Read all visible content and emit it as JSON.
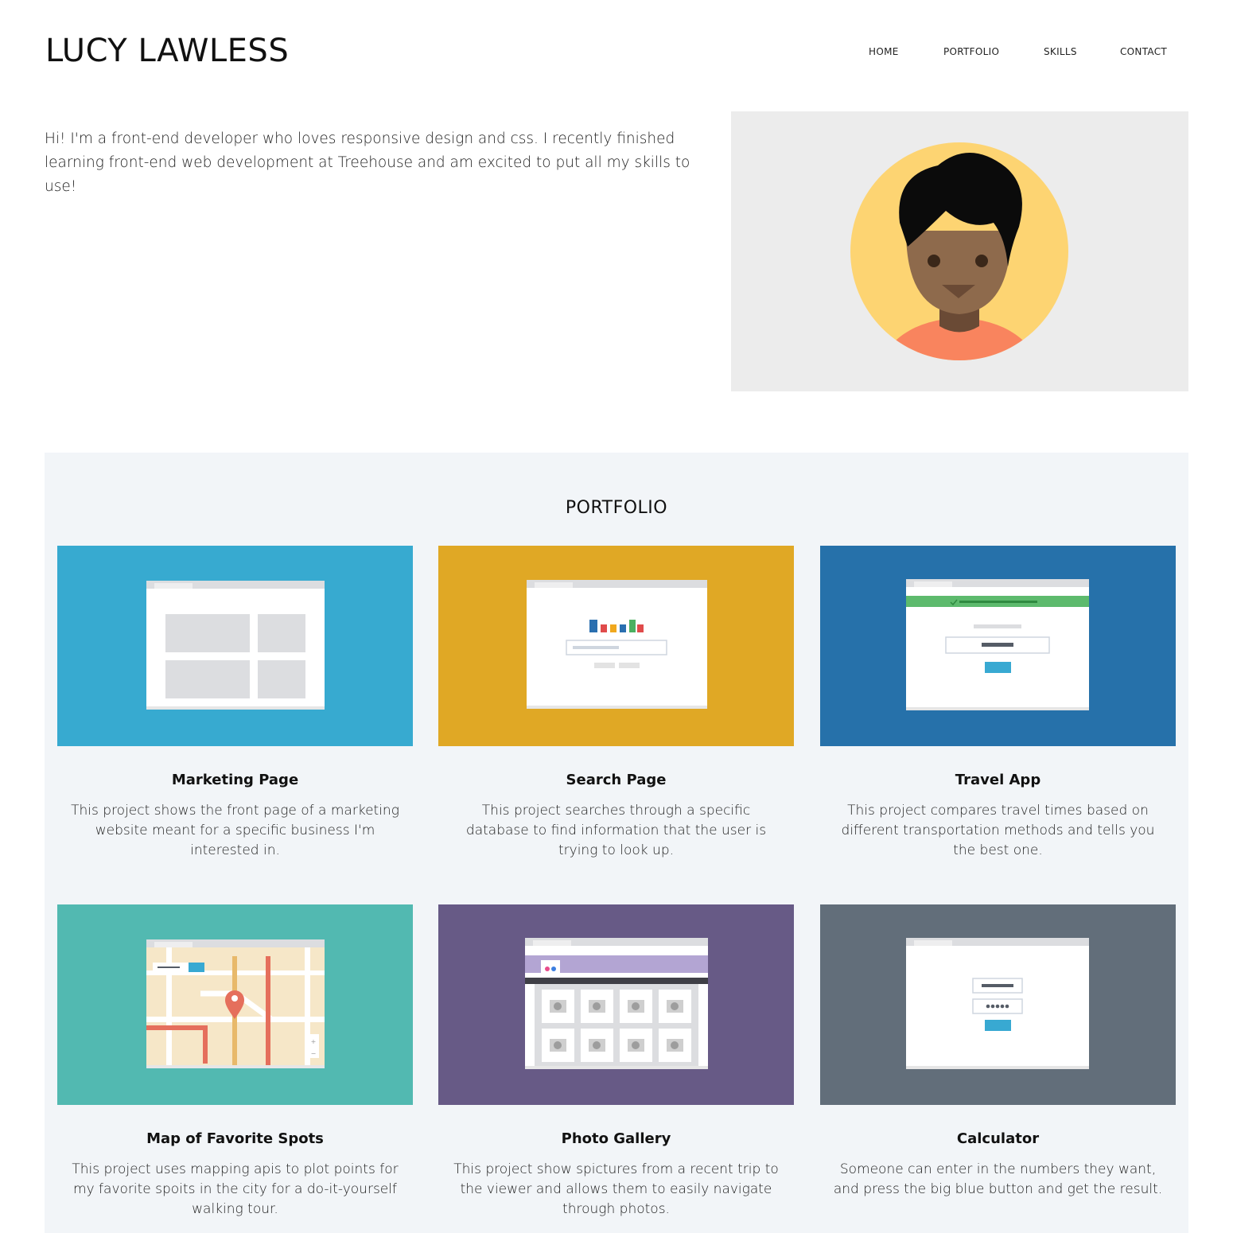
{
  "header": {
    "title": "LUCY LAWLESS",
    "nav": [
      {
        "label": "HOME"
      },
      {
        "label": "PORTFOLIO"
      },
      {
        "label": "SKILLS"
      },
      {
        "label": "CONTACT"
      }
    ]
  },
  "intro": {
    "text": "Hi! I'm a front-end developer who loves responsive design and css. I recently finished learning front-end web development at Treehouse and am excited to put all my skills to use!",
    "avatar_icon": "avatar-illustration"
  },
  "portfolio": {
    "title": "PORTFOLIO",
    "projects": [
      {
        "title": "Marketing Page",
        "description": "This project shows the front page of a marketing website meant for a specific business I'm interested in.",
        "color": "#37aad0"
      },
      {
        "title": "Search Page",
        "description": "This project searches through a specific database to find information that the user is trying to look up.",
        "color": "#e0a825"
      },
      {
        "title": "Travel App",
        "description": "This project compares travel times based on different transportation methods and tells you the best one.",
        "color": "#2671aa"
      },
      {
        "title": "Map of Favorite Spots",
        "description": "This project uses mapping apis to plot points for my favorite spoits in the city for a do-it-yourself walking tour.",
        "color": "#52b9b1"
      },
      {
        "title": "Photo Gallery",
        "description": "This project show spictures from a recent trip to the viewer and allows them to easily navigate through photos.",
        "color": "#675a86"
      },
      {
        "title": "Calculator",
        "description": "Someone can enter in the numbers they want, and press the big blue button and get the result.",
        "color": "#626e7a"
      }
    ]
  }
}
